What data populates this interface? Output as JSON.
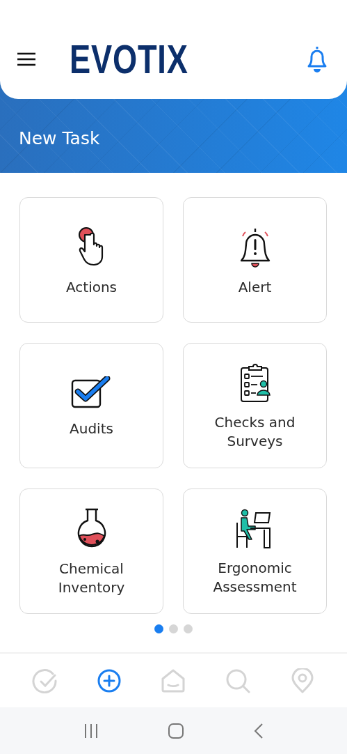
{
  "header": {
    "logo": "EVOTIX"
  },
  "banner": {
    "title": "New Task"
  },
  "tiles": [
    {
      "label": "Actions",
      "kind": "tap"
    },
    {
      "label": "Alert",
      "kind": "alarm"
    },
    {
      "label": "Audits",
      "kind": "checkbox"
    },
    {
      "label": "Checks and Surveys",
      "kind": "clipboard"
    },
    {
      "label": "Chemical Inventory",
      "kind": "flask"
    },
    {
      "label": "Ergonomic Assessment",
      "kind": "desk"
    }
  ],
  "pager": [
    {
      "selected": true
    },
    {
      "selected": false
    },
    {
      "selected": false
    }
  ],
  "bottom_nav": [
    {
      "kind": "tasks",
      "selected": false
    },
    {
      "kind": "add",
      "selected": true
    },
    {
      "kind": "home",
      "selected": false
    },
    {
      "kind": "search",
      "selected": false
    },
    {
      "kind": "location",
      "selected": false
    }
  ]
}
